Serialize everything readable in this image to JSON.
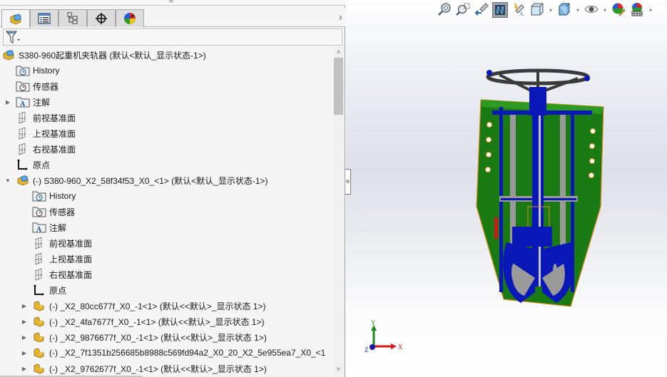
{
  "feature_manager": {
    "tabs": [
      {
        "name": "featuremanager-tree",
        "icon": "featuremanager-icon",
        "active": true
      },
      {
        "name": "property-manager",
        "icon": "property-manager-icon",
        "active": false
      },
      {
        "name": "configuration-manager",
        "icon": "configuration-manager-icon",
        "active": false
      },
      {
        "name": "dimxpert-manager",
        "icon": "dimxpert-icon",
        "active": false
      },
      {
        "name": "display-manager",
        "icon": "display-manager-icon",
        "active": false
      }
    ],
    "more_tabs_glyph": "›",
    "filter_icon": "filter-icon",
    "tree": [
      {
        "level": 0,
        "arrow": "",
        "icon": "assembly-icon",
        "label": "S380-960起重机夹轨器  (默认<默认_显示状态-1>)"
      },
      {
        "level": 1,
        "arrow": "",
        "icon": "history-folder-icon",
        "label": "History"
      },
      {
        "level": 1,
        "arrow": "",
        "icon": "sensor-folder-icon",
        "label": "传感器"
      },
      {
        "level": 1,
        "arrow": "▶",
        "icon": "annotation-folder-icon",
        "label": "注解"
      },
      {
        "level": 1,
        "arrow": "",
        "icon": "plane-icon",
        "label": "前视基准面"
      },
      {
        "level": 1,
        "arrow": "",
        "icon": "plane-icon",
        "label": "上视基准面"
      },
      {
        "level": 1,
        "arrow": "",
        "icon": "plane-icon",
        "label": "右视基准面"
      },
      {
        "level": 1,
        "arrow": "",
        "icon": "origin-icon",
        "label": "原点"
      },
      {
        "level": 1,
        "arrow": "▼",
        "icon": "assembly-icon",
        "label": "(-) S380-960_X2_58f34f53_X0_<1> (默认<默认_显示状态-1>)"
      },
      {
        "level": 2,
        "arrow": "",
        "icon": "history-folder-icon",
        "label": "History"
      },
      {
        "level": 2,
        "arrow": "",
        "icon": "sensor-folder-icon",
        "label": "传感器"
      },
      {
        "level": 2,
        "arrow": "",
        "icon": "annotation-folder-icon",
        "label": "注解"
      },
      {
        "level": 2,
        "arrow": "",
        "icon": "plane-icon",
        "label": "前视基准面"
      },
      {
        "level": 2,
        "arrow": "",
        "icon": "plane-icon",
        "label": "上视基准面"
      },
      {
        "level": 2,
        "arrow": "",
        "icon": "plane-icon",
        "label": "右视基准面"
      },
      {
        "level": 2,
        "arrow": "",
        "icon": "origin-icon",
        "label": "原点"
      },
      {
        "level": 2,
        "arrow": "▶",
        "icon": "part-icon",
        "label": "(-) _X2_80cc677f_X0_-1<1> (默认<<默认>_显示状态 1>)"
      },
      {
        "level": 2,
        "arrow": "▶",
        "icon": "part-icon",
        "label": "(-) _X2_4fa7677f_X0_-1<1> (默认<<默认>_显示状态 1>)"
      },
      {
        "level": 2,
        "arrow": "▶",
        "icon": "part-icon",
        "label": "(-) _X2_9876677f_X0_-1<1> (默认<<默认>_显示状态 1>)"
      },
      {
        "level": 2,
        "arrow": "▶",
        "icon": "part-icon",
        "label": "(-) _X2_7f1351b256685b8988c569fd94a2_X0_20_X2_5e955ea7_X0_<1"
      },
      {
        "level": 2,
        "arrow": "▶",
        "icon": "part-icon",
        "label": "(-) _X2_9762677f_X0_-1<1> (默认<<默认>_显示状态 1>)"
      }
    ],
    "scroll": {
      "up": "˄",
      "down": "˅"
    }
  },
  "heads_up_toolbar": [
    {
      "name": "zoom-to-fit",
      "icon": "zoom-to-fit-icon",
      "active": false,
      "dropdown": false
    },
    {
      "name": "zoom-to-area",
      "icon": "zoom-to-area-icon",
      "active": false,
      "dropdown": false
    },
    {
      "name": "previous-view",
      "icon": "previous-view-icon",
      "active": false,
      "dropdown": false
    },
    {
      "name": "section-view",
      "icon": "section-view-icon",
      "active": true,
      "dropdown": false
    },
    {
      "name": "dynamic-annotation-views",
      "icon": "dynamic-annotation-icon",
      "active": false,
      "dropdown": false
    },
    {
      "name": "view-orientation",
      "icon": "view-orientation-icon",
      "active": false,
      "dropdown": true
    },
    {
      "name": "display-style",
      "icon": "display-style-icon",
      "active": false,
      "dropdown": true
    },
    {
      "name": "hide-show-items",
      "icon": "hide-show-eye-icon",
      "active": false,
      "dropdown": true
    },
    {
      "name": "edit-appearance",
      "icon": "edit-appearance-icon",
      "active": false,
      "dropdown": false
    },
    {
      "name": "apply-scene",
      "icon": "apply-scene-icon",
      "active": false,
      "dropdown": true
    }
  ],
  "triad": {
    "x_label": "X",
    "y_label": "Y",
    "z_label": "Z"
  },
  "colors": {
    "plate_green": "#1a7a14",
    "part_blue": "#0a18b8",
    "frame_gray": "#9a9a9a",
    "edge_orange": "#e08a1e",
    "handwheel_dark": "#3a3a3a",
    "axis_x": "#d01818",
    "axis_y": "#1a8a1a",
    "axis_z": "#1a1aa0"
  }
}
